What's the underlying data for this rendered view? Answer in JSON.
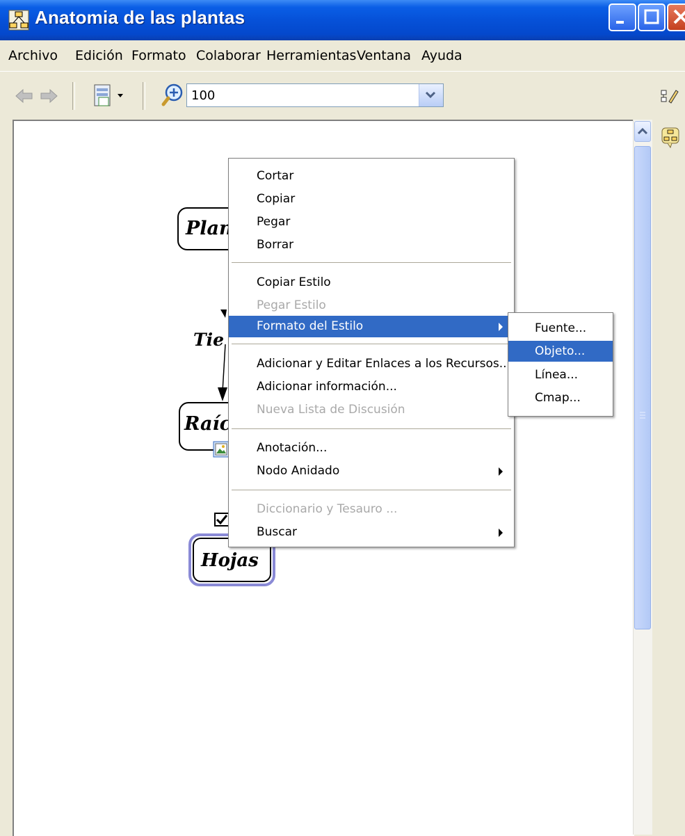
{
  "window": {
    "title": "Anatomia de las plantas"
  },
  "menubar": {
    "items": [
      "Archivo",
      "Edición",
      "Formato",
      "Colaborar",
      "Herramientas",
      "Ventana",
      "Ayuda"
    ]
  },
  "toolbar": {
    "zoom_value": "100"
  },
  "concept_map": {
    "nodes": [
      "Plan",
      "Raíc",
      "Hojas"
    ],
    "link_label": "Tie"
  },
  "context_menu": {
    "items": [
      {
        "label": "Cortar",
        "enabled": true
      },
      {
        "label": "Copiar",
        "enabled": true
      },
      {
        "label": "Pegar",
        "enabled": true
      },
      {
        "label": "Borrar",
        "enabled": true
      },
      {
        "label": "Copiar Estilo",
        "enabled": true
      },
      {
        "label": "Pegar Estilo",
        "enabled": false
      },
      {
        "label": "Formato del Estilo",
        "enabled": true,
        "submenu": true,
        "highlighted": true
      },
      {
        "label": "Adicionar y Editar Enlaces a los Recursos...",
        "enabled": true
      },
      {
        "label": "Adicionar información...",
        "enabled": true
      },
      {
        "label": "Nueva Lista de Discusión",
        "enabled": false
      },
      {
        "label": "Anotación...",
        "enabled": true
      },
      {
        "label": "Nodo Anidado",
        "enabled": true,
        "submenu": true
      },
      {
        "label": "Diccionario y Tesauro ...",
        "enabled": false
      },
      {
        "label": "Buscar",
        "enabled": true,
        "submenu": true
      }
    ]
  },
  "submenu": {
    "items": [
      "Fuente...",
      "Objeto...",
      "Línea...",
      "Cmap..."
    ],
    "highlighted": "Objeto..."
  },
  "colors": {
    "titlebar": "#0651d8",
    "highlight": "#316ac5",
    "disabled_text": "#a9a9a9",
    "selected_node_border": "#8a8ad6"
  }
}
